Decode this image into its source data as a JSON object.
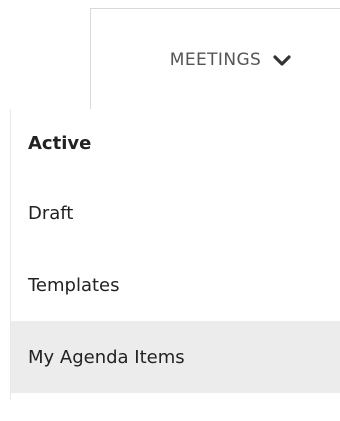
{
  "menu_tab": {
    "label": "MEETINGS",
    "icon": "chevron-down-icon"
  },
  "dropdown": {
    "items": [
      {
        "label": "Active",
        "state": "selected"
      },
      {
        "label": "Draft",
        "state": "default"
      },
      {
        "label": "Templates",
        "state": "default"
      },
      {
        "label": "My Agenda Items",
        "state": "hovered"
      }
    ]
  },
  "colors": {
    "hover_background": "#ececec",
    "tab_border": "#d9d9d9",
    "tab_text": "#555555",
    "item_text": "#222222"
  }
}
